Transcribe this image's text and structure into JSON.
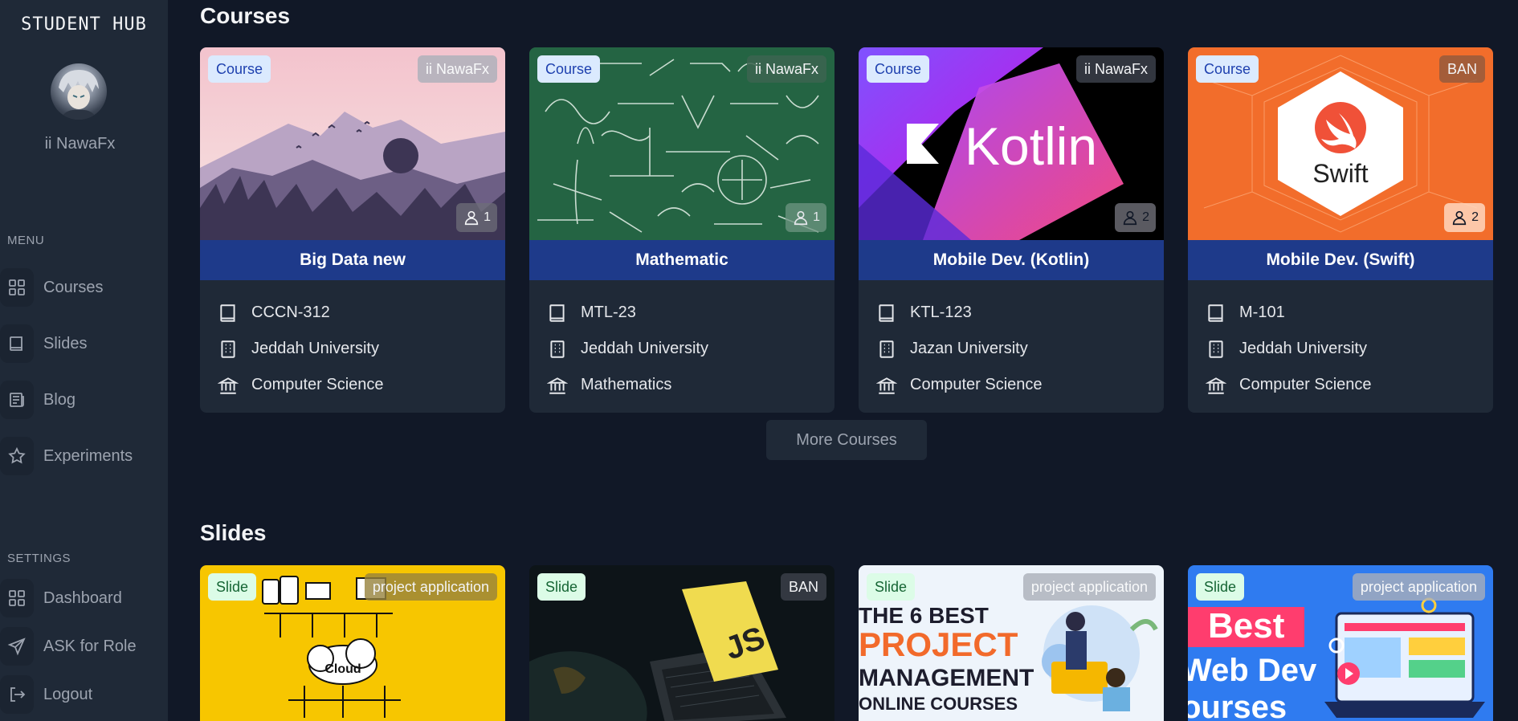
{
  "sidebar": {
    "brand": "STUDENT HUB",
    "username": "ii NawaFx",
    "menu_label": "MENU",
    "settings_label": "SETTINGS",
    "menu_items": [
      {
        "label": "Courses",
        "icon": "grid-icon"
      },
      {
        "label": "Slides",
        "icon": "book-icon"
      },
      {
        "label": "Blog",
        "icon": "newspaper-icon"
      },
      {
        "label": "Experiments",
        "icon": "star-icon"
      }
    ],
    "settings_items": [
      {
        "label": "Dashboard",
        "icon": "grid-icon"
      },
      {
        "label": "ASK for Role",
        "icon": "send-icon"
      },
      {
        "label": "Logout",
        "icon": "logout-icon"
      }
    ]
  },
  "courses_section": {
    "title": "Courses",
    "more_button": "More Courses",
    "cards": [
      {
        "type": "Course",
        "owner": "ii NawaFx",
        "members": "1",
        "title": "Big Data new",
        "code": "CCCN-312",
        "university": "Jeddah University",
        "department": "Computer Science"
      },
      {
        "type": "Course",
        "owner": "ii NawaFx",
        "members": "1",
        "title": "Mathematic",
        "code": "MTL-23",
        "university": "Jeddah University",
        "department": "Mathematics"
      },
      {
        "type": "Course",
        "owner": "ii NawaFx",
        "members": "2",
        "title": "Mobile Dev. (Kotlin)",
        "code": "KTL-123",
        "university": "Jazan University",
        "department": "Computer Science",
        "image_text": "Kotlin"
      },
      {
        "type": "Course",
        "owner": "BAN",
        "members": "2",
        "title": "Mobile Dev. (Swift)",
        "code": "M-101",
        "university": "Jeddah University",
        "department": "Computer Science",
        "image_text": "Swift"
      }
    ]
  },
  "slides_section": {
    "title": "Slides",
    "cards": [
      {
        "type": "Slide",
        "owner": "project application",
        "image_text": "Cloud"
      },
      {
        "type": "Slide",
        "owner": "BAN",
        "image_text": "JS"
      },
      {
        "type": "Slide",
        "owner": "project application",
        "image_text": [
          "THE 6 BEST",
          "PROJECT",
          "MANAGEMENT",
          "ONLINE COURSES"
        ]
      },
      {
        "type": "Slide",
        "owner": "project application",
        "image_text": [
          "Best",
          "Web Dev",
          "ourses"
        ]
      }
    ]
  },
  "colors": {
    "background": "#111827",
    "sidebar": "#1f2937",
    "card_title_bar": "#1e3a8a",
    "course_chip": "#dbeafe",
    "slide_chip": "#dcfce7"
  }
}
